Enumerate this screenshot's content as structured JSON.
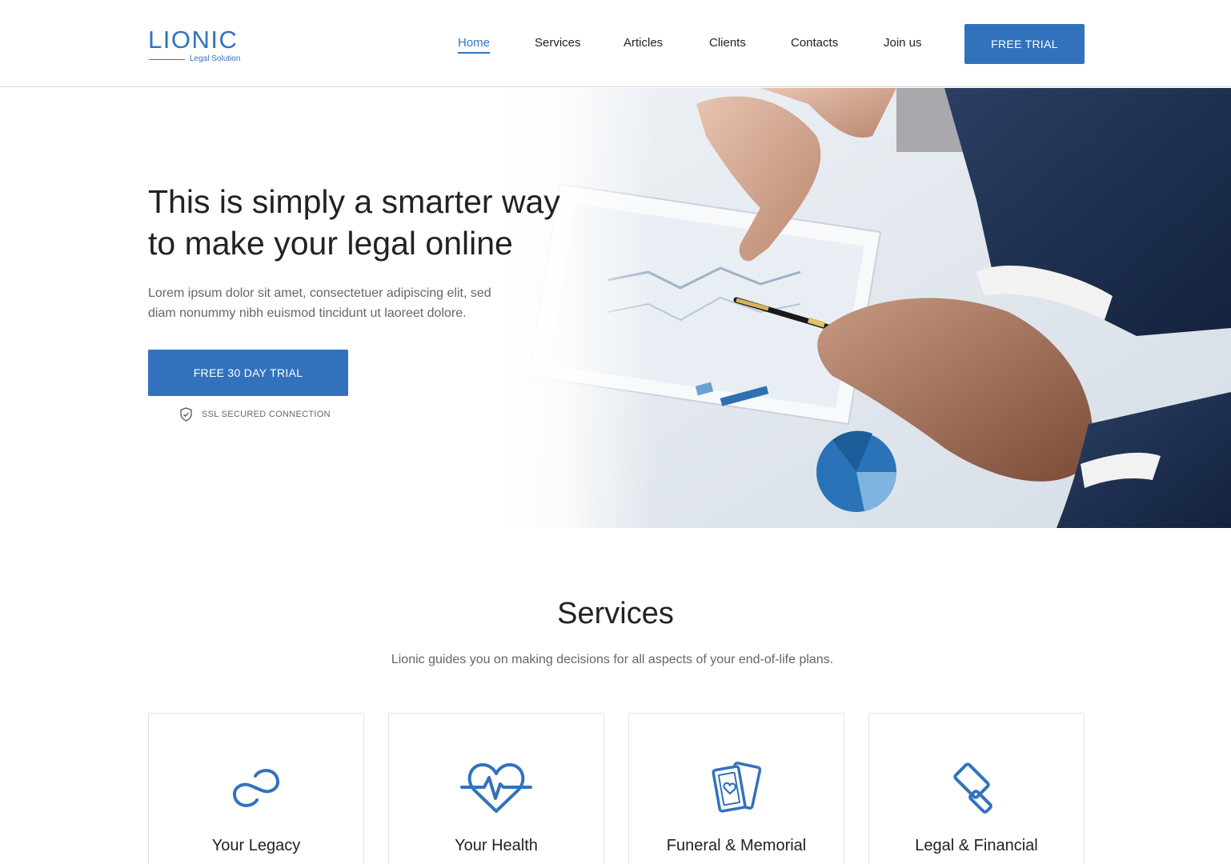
{
  "brand": {
    "name": "LIONIC",
    "tagline": "Legal Solution"
  },
  "nav": {
    "items": [
      {
        "label": "Home",
        "active": true
      },
      {
        "label": "Services",
        "active": false
      },
      {
        "label": "Articles",
        "active": false
      },
      {
        "label": "Clients",
        "active": false
      },
      {
        "label": "Contacts",
        "active": false
      },
      {
        "label": "Join us",
        "active": false
      }
    ],
    "cta_label": "FREE TRIAL"
  },
  "hero": {
    "title_line1": "This is simply a smarter way",
    "title_line2": "to make your legal online",
    "text_line1": "Lorem ipsum dolor sit amet, consectetuer adipiscing elit, sed",
    "text_line2": "diam nonummy nibh euismod tincidunt ut laoreet dolore.",
    "cta_label": "FREE 30 DAY TRIAL",
    "ssl_label": "SSL SECURED CONNECTION",
    "ssl_icon": "shield-check-icon",
    "image": "business-hands-pen-documents-photo"
  },
  "services": {
    "title": "Services",
    "subtitle": "Lionic guides you on making decisions for all aspects of your end-of-life plans.",
    "cards": [
      {
        "title": "Your Legacy",
        "icon": "infinity-icon"
      },
      {
        "title": "Your Health",
        "icon": "heartbeat-icon"
      },
      {
        "title": "Funeral & Memorial",
        "icon": "cards-heart-icon"
      },
      {
        "title": "Legal & Financial",
        "icon": "gavel-icon"
      }
    ]
  },
  "colors": {
    "accent": "#3272bd",
    "text": "#222222",
    "muted": "#666666",
    "border": "#e3e3e3"
  }
}
